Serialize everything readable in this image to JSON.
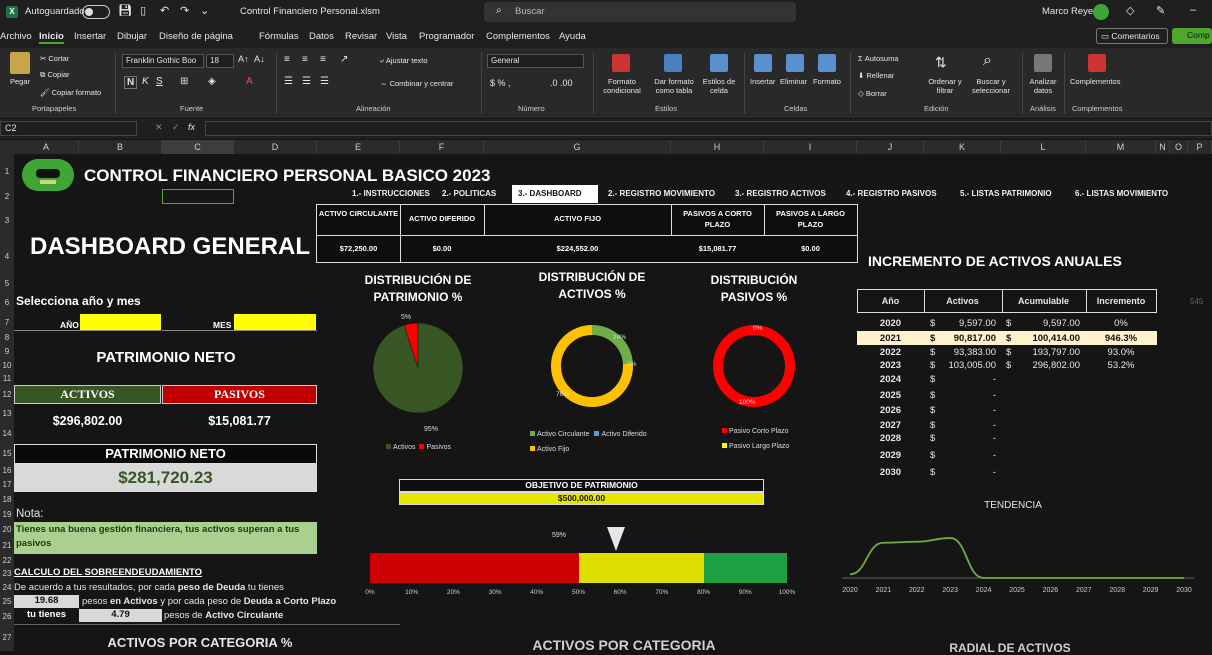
{
  "titlebar": {
    "autosave_label": "Autoguardado",
    "search_placeholder": "Buscar",
    "file_name": "Control Financiero Personal.xlsm",
    "user_name": "Marco Reyes"
  },
  "menu": [
    "Archivo",
    "Inicio",
    "Insertar",
    "Dibujar",
    "Diseño de página",
    "Fórmulas",
    "Datos",
    "Revisar",
    "Vista",
    "Programador",
    "Complementos",
    "Ayuda"
  ],
  "menu_active": "Inicio",
  "comments_button": "Comentarios",
  "share_button": "Comp",
  "ribbon": {
    "paste": "Pegar",
    "cut": "Cortar",
    "copy": "Copiar",
    "format_painter": "Copiar formato",
    "clipboard": "Portapapeles",
    "font_name": "Franklin Gothic Boo",
    "font_size": "18",
    "font_group": "Fuente",
    "wrap_text": "Ajustar texto",
    "merge_center": "Combinar y centrar",
    "alignment": "Alineación",
    "number_format": "General",
    "number": "Número",
    "cond_format": "Formato condicional",
    "format_table": "Dar formato como tabla",
    "cell_styles": "Estilos de celda",
    "styles": "Estilos",
    "insert": "Insertar",
    "delete": "Eliminar",
    "format": "Formato",
    "cells": "Celdas",
    "autosum": "Autosuma",
    "fill": "Rellenar",
    "clear": "Borrar",
    "sort_filter": "Ordenar y filtrar",
    "find_select": "Buscar y seleccionar",
    "editing": "Edición",
    "analyze": "Analizar datos",
    "analysis": "Análisis",
    "addins": "Complementos",
    "addins_group": "Complementos"
  },
  "namebox": "C2",
  "fx_label": "fx",
  "columns": [
    "A",
    "B",
    "C",
    "D",
    "E",
    "F",
    "G",
    "H",
    "I",
    "J",
    "K",
    "L",
    "M",
    "N",
    "O",
    "P"
  ],
  "rows": [
    "1",
    "2",
    "3",
    "4",
    "5",
    "6",
    "7",
    "8",
    "9",
    "10",
    "11",
    "12",
    "13",
    "14",
    "15",
    "16",
    "17",
    "18",
    "19",
    "20",
    "21",
    "22",
    "23",
    "24",
    "25",
    "26",
    "27"
  ],
  "header": {
    "title": "CONTROL FINANCIERO PERSONAL BASICO 2023"
  },
  "tabs": [
    "1.- INSTRUCCIONES",
    "2.- POLITICAS",
    "3.- DASHBOARD",
    "2.- REGISTRO MOVIMIENTO",
    "3.- REGISTRO ACTIVOS",
    "4.- REGISTRO PASIVOS",
    "5.- LISTAS PATRIMONIO",
    "6.- LISTAS MOVIMIENTO"
  ],
  "kpis": [
    {
      "label": "ACTIVO CIRCULANTE",
      "value": "$72,250.00"
    },
    {
      "label": "ACTIVO DIFERIDO",
      "value": "$0.00"
    },
    {
      "label": "ACTIVO FIJO",
      "value": "$224,552.00"
    },
    {
      "label": "PASIVOS A CORTO PLAZO",
      "value": "$15,081.77"
    },
    {
      "label": "PASIVOS A LARGO PLAZO",
      "value": "$0.00"
    }
  ],
  "left": {
    "dashboard_title": "DASHBOARD GENERAL",
    "select_label": "Selecciona año y mes",
    "year_label": "AÑO",
    "month_label": "MES",
    "net_worth_title": "PATRIMONIO NETO",
    "assets_label": "ACTIVOS",
    "liabilities_label": "PASIVOS",
    "assets_value": "$296,802.00",
    "liabilities_value": "$15,081.77",
    "net_label": "PATRIMONIO NETO",
    "net_value": "$281,720.23",
    "note_label": "Nota:",
    "note_text": "Tienes una buena gestión financiera, tus activos superan a tus pasivos",
    "debt_title": "CALCULO DEL SOBREENDEUDAMIENTO",
    "debt_line1_a": "De acuerdo a tus resultados, por cada ",
    "debt_line1_b": "peso de Deuda",
    "debt_line1_c": " tu tienes",
    "debt_value1": "19.68",
    "debt_line2_a": "pesos ",
    "debt_line2_b": "en Activos",
    "debt_line2_c": " y por cada peso de ",
    "debt_line2_d": "Deuda a Corto Plazo",
    "debt_line3_a": "tu tienes",
    "debt_value2": "4.79",
    "debt_line3_b": "pesos de ",
    "debt_line3_c": "Activo Circulante",
    "bottom_title": "ACTIVOS POR CATEGORIA %"
  },
  "charts": {
    "pie_patrimonio": {
      "title": "DISTRIBUCIÓN DE PATRIMONIO %",
      "label_small": "5%",
      "label_big": "95%",
      "legend": [
        "Activos",
        "Pasivos"
      ],
      "colors": [
        "#375623",
        "#ff0000"
      ],
      "values": [
        95,
        5
      ]
    },
    "donut_activos": {
      "title": "DISTRIBUCIÓN DE ACTIVOS %",
      "labels": [
        "24%",
        "0%",
        "76%"
      ],
      "legend": [
        "Activo Circulante",
        "Activo Diferido",
        "Activo Fijo"
      ],
      "colors": [
        "#70ad47",
        "#5b9bd5",
        "#ffc000"
      ],
      "values": [
        24,
        0,
        76
      ]
    },
    "donut_pasivos": {
      "title": "DISTRIBUCIÓN PASIVOS %",
      "labels": [
        "0%",
        "100%"
      ],
      "legend": [
        "Pasivo Corto Plazo",
        "Pasivo Largo Plazo"
      ],
      "colors": [
        "#ff0000",
        "#ffff00"
      ],
      "values": [
        100,
        0
      ]
    },
    "objective": {
      "title": "OBJETIVO DE PATRIMONIO",
      "value": "$500,000.00",
      "progress_label": "59%",
      "progress": 59,
      "ticks": [
        "0%",
        "10%",
        "20%",
        "30%",
        "40%",
        "50%",
        "60%",
        "70%",
        "80%",
        "90%",
        "100%"
      ]
    },
    "activos_cat_title": "ACTIVOS POR CATEGORIA",
    "radial_title": "RADIAL DE ACTIVOS"
  },
  "annual": {
    "title": "INCREMENTO DE ACTIVOS ANUALES",
    "headers": [
      "Año",
      "Activos",
      "Acumulable",
      "Incremento"
    ],
    "rows": [
      {
        "year": "2020",
        "s1": "$",
        "activos": "9,597.00",
        "s2": "$",
        "acum": "9,597.00",
        "inc": "0%"
      },
      {
        "year": "2021",
        "s1": "$",
        "activos": "90,817.00",
        "s2": "$",
        "acum": "100,414.00",
        "inc": "946.3%"
      },
      {
        "year": "2022",
        "s1": "$",
        "activos": "93,383.00",
        "s2": "$",
        "acum": "193,797.00",
        "inc": "93.0%"
      },
      {
        "year": "2023",
        "s1": "$",
        "activos": "103,005.00",
        "s2": "$",
        "acum": "296,802.00",
        "inc": "53.2%"
      },
      {
        "year": "2024",
        "s1": "$",
        "activos": "-",
        "s2": "",
        "acum": "",
        "inc": ""
      },
      {
        "year": "2025",
        "s1": "$",
        "activos": "-",
        "s2": "",
        "acum": "",
        "inc": ""
      },
      {
        "year": "2026",
        "s1": "$",
        "activos": "-",
        "s2": "",
        "acum": "",
        "inc": ""
      },
      {
        "year": "2027",
        "s1": "$",
        "activos": "-",
        "s2": "",
        "acum": "",
        "inc": ""
      },
      {
        "year": "2028",
        "s1": "$",
        "activos": "-",
        "s2": "",
        "acum": "",
        "inc": ""
      },
      {
        "year": "2029",
        "s1": "$",
        "activos": "-",
        "s2": "",
        "acum": "",
        "inc": ""
      },
      {
        "year": "2030",
        "s1": "$",
        "activos": "-",
        "s2": "",
        "acum": "",
        "inc": ""
      }
    ],
    "side_note": "545"
  },
  "chart_data": {
    "type": "line",
    "title": "TENDENCIA",
    "x": [
      "2020",
      "2021",
      "2022",
      "2023",
      "2024",
      "2025",
      "2026",
      "2027",
      "2028",
      "2029",
      "2030"
    ],
    "series": [
      {
        "values": [
          9597,
          90817,
          93383,
          103005,
          0,
          0,
          0,
          0,
          0,
          0,
          0
        ]
      }
    ],
    "xlabel": "",
    "ylabel": "",
    "grid": false,
    "color": "#70ad47"
  }
}
